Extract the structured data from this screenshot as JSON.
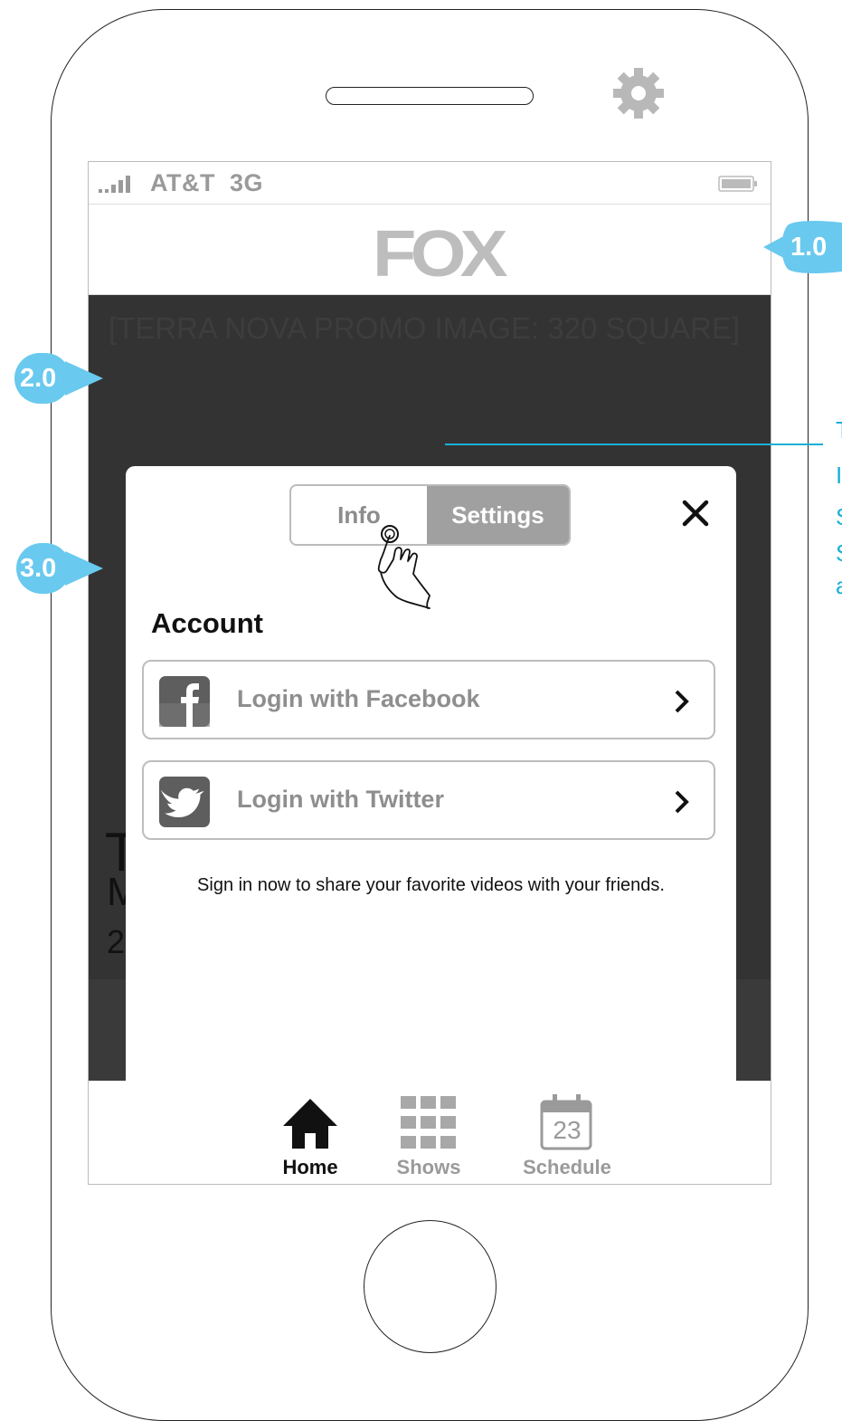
{
  "status_bar": {
    "carrier": "AT&T  3G"
  },
  "nav": {
    "logo": "FOX"
  },
  "background": {
    "promo_text": "[TERRA NOVA PROMO IMAGE: 320 SQUARE]",
    "title_char": "T",
    "subtitle_char": "M",
    "meta_char": "2"
  },
  "modal": {
    "tabs": {
      "info": "Info",
      "settings": "Settings"
    },
    "section_title": "Account",
    "facebook_label": "Login with Facebook",
    "twitter_label": "Login with Twitter",
    "share_note": "Sign in now to share your favorite videos with your friends."
  },
  "tabbar": {
    "home": "Home",
    "shows": "Shows",
    "schedule": "Schedule",
    "schedule_day": "23"
  },
  "annotations": {
    "a1": "1.0",
    "a2": "2.0",
    "a3": "3.0",
    "side_letters": [
      "T",
      "I",
      "S",
      "S",
      "a"
    ]
  },
  "colors": {
    "annotation": "#69c9ee",
    "annotation_line": "#1ab0d8",
    "overlay": "#333333"
  }
}
